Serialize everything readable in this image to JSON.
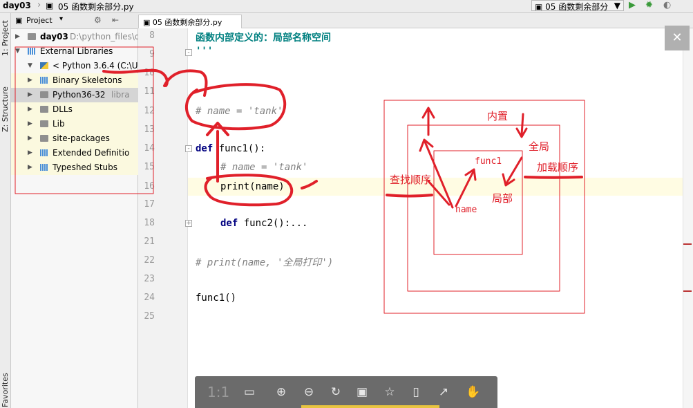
{
  "topbar": {
    "crumb1": "day03",
    "crumb2": "05 函数剩余部分.py",
    "run_config": "05 函数剩余部分",
    "run_icon": "play-icon",
    "debug_icon": "bug-icon"
  },
  "toolstrip": {
    "project_tab": "1: Project",
    "structure_tab": "Z: Structure",
    "favorites_tab": "Favorites"
  },
  "project": {
    "header": "Project",
    "items": [
      {
        "label": "day03",
        "extra": "D:\\python_files\\d",
        "indent": 0,
        "expanded": false,
        "icon": "folder"
      },
      {
        "label": "External Libraries",
        "extra": "",
        "indent": 0,
        "expanded": true,
        "icon": "library"
      },
      {
        "label": "< Python 3.6.4 (C:\\Us",
        "extra": "",
        "indent": 1,
        "expanded": true,
        "icon": "python"
      },
      {
        "label": "Binary Skeletons",
        "extra": "",
        "indent": 2,
        "expanded": false,
        "icon": "library"
      },
      {
        "label": "Python36-32",
        "extra": "libra",
        "indent": 2,
        "expanded": false,
        "icon": "folder"
      },
      {
        "label": "DLLs",
        "extra": "",
        "indent": 2,
        "expanded": false,
        "icon": "folder"
      },
      {
        "label": "Lib",
        "extra": "",
        "indent": 2,
        "expanded": false,
        "icon": "folder"
      },
      {
        "label": "site-packages",
        "extra": "",
        "indent": 2,
        "expanded": false,
        "icon": "folder"
      },
      {
        "label": "Extended Definitio",
        "extra": "",
        "indent": 2,
        "expanded": false,
        "icon": "library"
      },
      {
        "label": "Typeshed Stubs",
        "extra": "",
        "indent": 2,
        "expanded": false,
        "icon": "library"
      }
    ]
  },
  "editor": {
    "tab_label": "05 函数剩余部分.py",
    "line_numbers": [
      "8",
      "9",
      "10",
      "11",
      "12",
      "13",
      "14",
      "15",
      "16",
      "17",
      "18",
      "21",
      "22",
      "23",
      "24",
      "25"
    ],
    "lines": {
      "l8": "函数内部定义的：局部名称空间",
      "l9": "'''",
      "l12": "# name = 'tank'",
      "l14_kw": "def",
      "l14_rest": " func1():",
      "l15": "# name = 'tank'",
      "l16": "print(name)",
      "l18_kw": "def",
      "l18_rest": " func2():...",
      "l22": "# print(name, '全局打印')",
      "l24": "func1()"
    }
  },
  "annotation": {
    "builtin": "内置",
    "global": "全局",
    "local": "局部",
    "func1": "func1",
    "name": "name",
    "lookup_order": "查找顺序",
    "load_order": "加载顺序"
  },
  "viewer": {
    "ratio": "1:1",
    "buttons": [
      "fit-screen-icon",
      "zoom-in-icon",
      "zoom-out-icon",
      "rotate-icon",
      "save-icon",
      "bookmark-icon",
      "tablet-icon",
      "share-icon",
      "like-icon"
    ]
  }
}
